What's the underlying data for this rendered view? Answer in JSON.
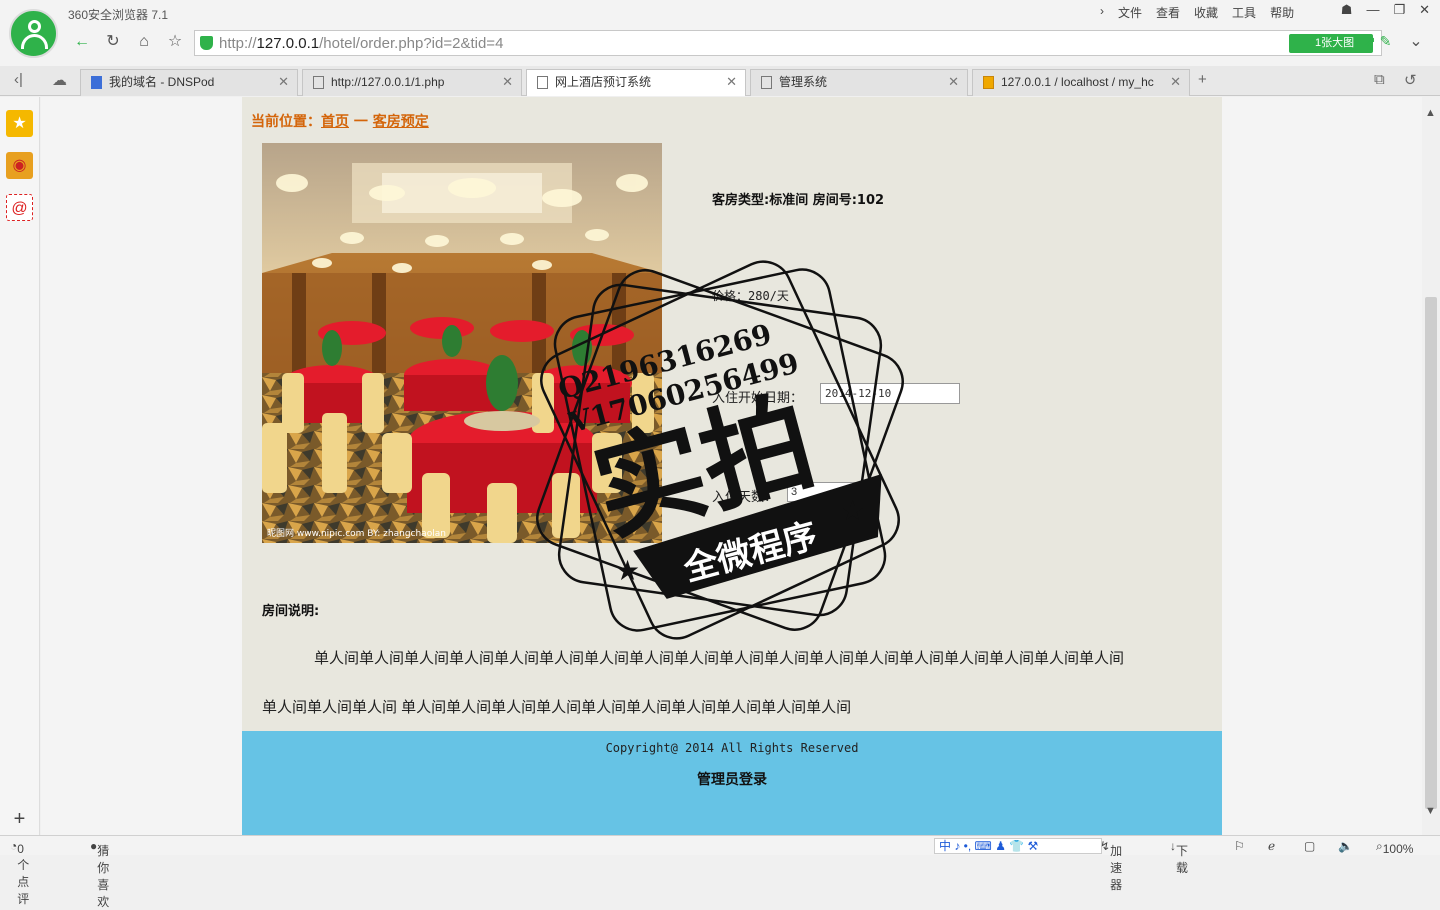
{
  "browser": {
    "app_title": "360安全浏览器 7.1",
    "menu": [
      "文件",
      "查看",
      "收藏",
      "工具",
      "帮助"
    ],
    "url_prefix": "http://",
    "url_host": "127.0.0.1",
    "url_path": "/hotel/order.php?id=2&tid=4",
    "bigpic_label": "1张大图",
    "tabs": [
      {
        "label": "我的域名 - DNSPod",
        "active": false
      },
      {
        "label": "http://127.0.0.1/1.php",
        "active": false
      },
      {
        "label": "网上酒店预订系统",
        "active": true
      },
      {
        "label": "管理系统",
        "active": false
      },
      {
        "label": "127.0.0.1 / localhost / my_hc",
        "active": false
      }
    ]
  },
  "page": {
    "breadcrumb_prefix": "当前位置：",
    "breadcrumb_home": "首页",
    "breadcrumb_sep": " 一 ",
    "breadcrumb_current": "客房预定",
    "room_type": "客房类型:标准间   房间号:102",
    "price": "价格：280/天",
    "checkin_label": "入住开始日期：",
    "checkin_value": "2014-12-10",
    "days_label": "入住天数：",
    "days_value": "3",
    "desc_title": "房间说明:",
    "desc_line1": "单人间单人间单人间单人间单人间单人间单人间单人间单人间单人间单人间单人间单人间单人间单人间单人间单人间单人间",
    "desc_line2": "单人间单人间单人间 单人间单人间单人间单人间单人间单人间单人间单人间单人间单人间",
    "copyright": "Copyright@ 2014 All Rights Reserved",
    "admin_login": "管理员登录",
    "photo_caption": "昵图网 www.nipic.com  BY: zhangchaolan"
  },
  "watermark": {
    "line1": "Q2196316269",
    "line2": "V17060256499",
    "big": "实拍",
    "banner": "全微程序"
  },
  "status": {
    "comments": "0个点评",
    "guess": "猜你喜欢",
    "ime": "中 ♪ •, ⌨ ♟ 👕 ⚒",
    "accelerator": "加速器",
    "download": "下载",
    "zoom": "100%"
  }
}
